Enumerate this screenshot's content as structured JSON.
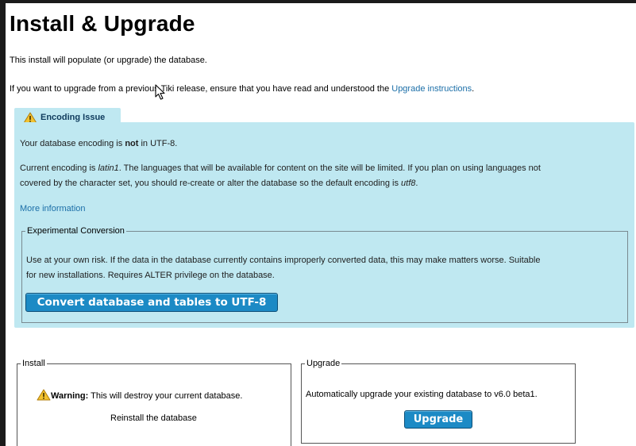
{
  "page": {
    "title": "Install & Upgrade",
    "intro": "This install will populate (or upgrade) the database.",
    "upgrade_note_prefix": "If you want to upgrade from a previous Tiki release, ensure that you have read and understood the ",
    "upgrade_link": "Upgrade instructions",
    "upgrade_note_suffix": "."
  },
  "encoding": {
    "tab_label": "Encoding Issue",
    "line1_prefix": "Your database encoding is ",
    "line1_bold": "not",
    "line1_suffix": " in UTF-8.",
    "line2_prefix": "Current encoding is ",
    "line2_enc": "latin1",
    "line2_mid": ". The languages that will be available for content on the site will be limited. If you plan on using languages not",
    "line3_prefix": "covered by the character set, you should re-create or alter the database so the default encoding is ",
    "line3_enc": "utf8",
    "line3_suffix": ".",
    "more_info": "More information",
    "conversion": {
      "legend": "Experimental Conversion",
      "line1": "Use at your own risk. If the data in the database currently contains improperly converted data, this may make matters worse. Suitable",
      "line2": "for new installations. Requires ALTER privilege on the database.",
      "button": "Convert database and tables to UTF-8"
    }
  },
  "install": {
    "legend": "Install",
    "warning_label": "Warning:",
    "warning_text": " This will destroy your current database.",
    "reinstall_link": "Reinstall the database"
  },
  "upgrade": {
    "legend": "Upgrade",
    "text": "Automatically upgrade your existing database to v6.0 beta1.",
    "button": "Upgrade"
  },
  "colors": {
    "info_background": "#bfe8f1",
    "button": "#1c8ac5",
    "link": "#1c6fa8"
  }
}
